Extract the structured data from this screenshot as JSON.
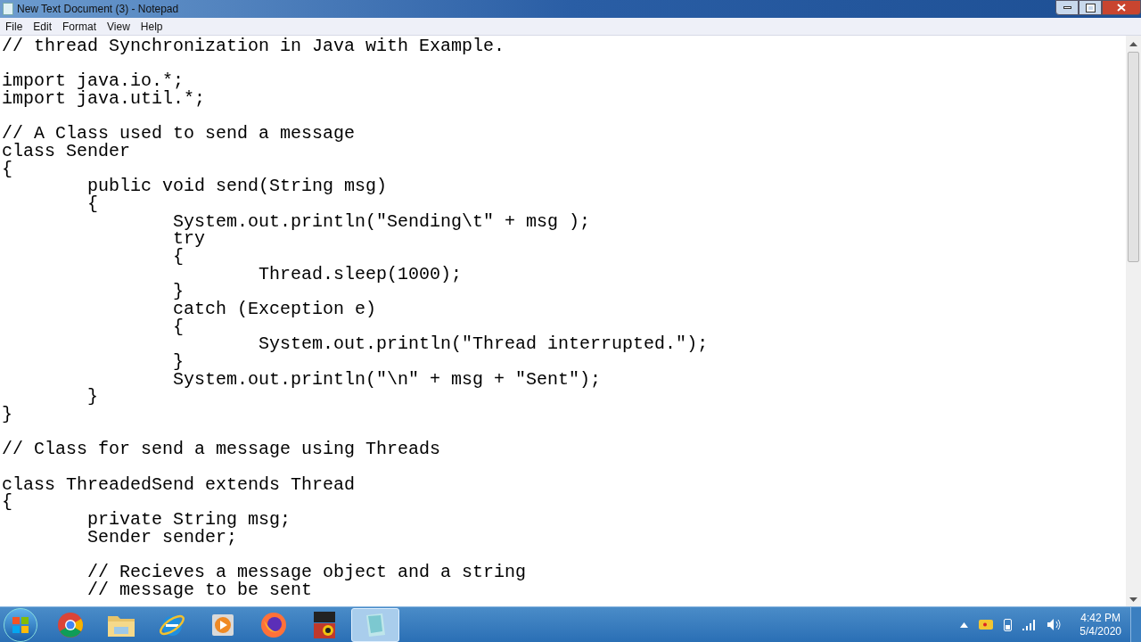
{
  "window": {
    "title": "New Text Document (3) - Notepad"
  },
  "menu": [
    "File",
    "Edit",
    "Format",
    "View",
    "Help"
  ],
  "lines": [
    {
      "kind": "code",
      "text": "// thread Synchronization in Java with Example."
    },
    {
      "kind": "blank"
    },
    {
      "kind": "code",
      "text": "import java.io.*;"
    },
    {
      "kind": "code",
      "text": "import java.util.*;"
    },
    {
      "kind": "blank"
    },
    {
      "kind": "code",
      "text": "// A Class used to send a message"
    },
    {
      "kind": "code",
      "text": "class Sender"
    },
    {
      "kind": "code",
      "text": "{"
    },
    {
      "kind": "code",
      "text": "\tpublic void send(String msg)"
    },
    {
      "kind": "code",
      "text": "\t{"
    },
    {
      "kind": "code",
      "text": "\t\tSystem.out.println(\"Sending\\t\" + msg );"
    },
    {
      "kind": "code",
      "text": "\t\ttry"
    },
    {
      "kind": "code",
      "text": "\t\t{"
    },
    {
      "kind": "code",
      "text": "\t\t\tThread.sleep(1000);"
    },
    {
      "kind": "code",
      "text": "\t\t}"
    },
    {
      "kind": "code",
      "text": "\t\tcatch (Exception e)"
    },
    {
      "kind": "code",
      "text": "\t\t{"
    },
    {
      "kind": "code",
      "text": "\t\t\tSystem.out.println(\"Thread interrupted.\");"
    },
    {
      "kind": "code",
      "text": "\t\t}"
    },
    {
      "kind": "code",
      "text": "\t\tSystem.out.println(\"\\n\" + msg + \"Sent\");"
    },
    {
      "kind": "code",
      "text": "\t}"
    },
    {
      "kind": "code",
      "text": "}"
    },
    {
      "kind": "blank"
    },
    {
      "kind": "code",
      "text": "// Class for send a message using Threads"
    },
    {
      "kind": "blank"
    },
    {
      "kind": "code",
      "text": "class ThreadedSend extends Thread"
    },
    {
      "kind": "code",
      "text": "{"
    },
    {
      "kind": "code",
      "text": "\tprivate String msg;"
    },
    {
      "kind": "code",
      "text": "\tSender sender;"
    },
    {
      "kind": "blank"
    },
    {
      "kind": "code",
      "text": "\t// Recieves a message object and a string"
    },
    {
      "kind": "code",
      "text": "\t// message to be sent"
    }
  ],
  "taskbar": {
    "items": [
      {
        "kind": "chrome",
        "selected": false
      },
      {
        "kind": "folder",
        "selected": false
      },
      {
        "kind": "ie",
        "selected": false
      },
      {
        "kind": "media",
        "selected": false
      },
      {
        "kind": "firefox",
        "selected": false
      },
      {
        "kind": "app",
        "selected": false
      },
      {
        "kind": "notepad",
        "selected": true
      }
    ],
    "time": "4:42 PM",
    "date": "5/4/2020"
  }
}
